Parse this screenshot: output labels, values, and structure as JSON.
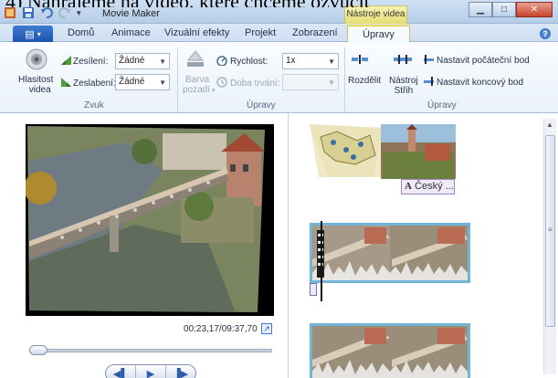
{
  "document": {
    "caption_cut": "4) Nahrajeme na video, které chceme ozvučit"
  },
  "window": {
    "title": "Movie Maker",
    "context_tab": "Nástroje videa"
  },
  "tabs": [
    "Domů",
    "Animace",
    "Vizuální efekty",
    "Projekt",
    "Zobrazení",
    "Úpravy"
  ],
  "active_tab": "Úpravy",
  "ribbon": {
    "zvuk": {
      "group_label": "Zvuk",
      "volume_button": [
        "Hlasitost",
        "videa"
      ],
      "fade_in_label": "Zesílení:",
      "fade_in_value": "Žádné",
      "fade_out_label": "Zeslabení:",
      "fade_out_value": "Žádné"
    },
    "upravy1": {
      "group_label": "Úpravy",
      "bg_color": [
        "Barva",
        "pozadí"
      ],
      "speed_label": "Rychlost:",
      "speed_value": "1x",
      "duration_label": "Doba trvání:",
      "duration_value": ""
    },
    "upravy2": {
      "group_label": "Úpravy",
      "split": "Rozdělit",
      "trim": [
        "Nástroj",
        "Střih"
      ],
      "set_start": "Nastavit počáteční bod",
      "set_end": "Nastavit koncový bod"
    }
  },
  "preview": {
    "time": "00:23,17/09:37,70"
  },
  "storyboard": {
    "caption_label": "Český ..."
  },
  "colors": {
    "accent": "#1d55ae",
    "context": "#e6dd73",
    "clip_border": "#6fb5d6"
  }
}
